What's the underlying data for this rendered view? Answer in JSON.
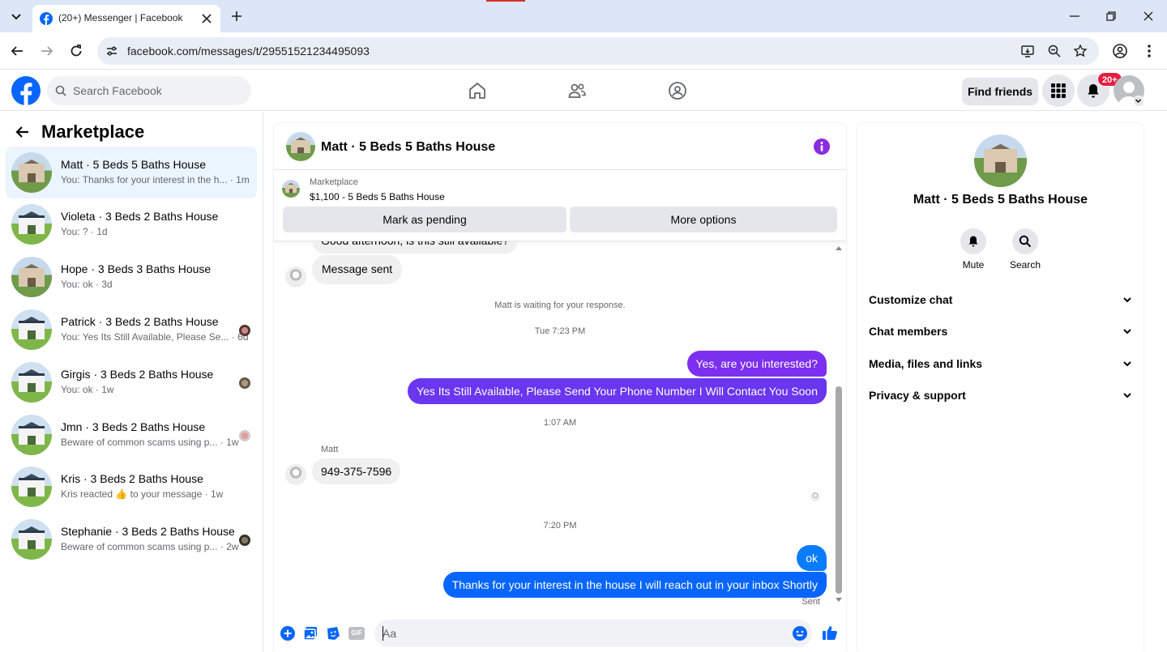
{
  "browser": {
    "tab_title": "(20+) Messenger | Facebook",
    "url": "facebook.com/messages/t/29551521234495093"
  },
  "header": {
    "search_placeholder": "Search Facebook",
    "find_friends": "Find friends",
    "notifications_badge": "20+"
  },
  "sidebar": {
    "title": "Marketplace",
    "conversations": [
      {
        "name": "Matt · 5 Beds 5 Baths House",
        "preview": "You: Thanks for your interest in the h... · 1m",
        "active": true
      },
      {
        "name": "Violeta · 3 Beds 2 Baths House",
        "preview": "You: ? · 1d"
      },
      {
        "name": "Hope · 3 Beds 3 Baths House",
        "preview": "You: ok · 3d"
      },
      {
        "name": "Patrick · 3 Beds 2 Baths House",
        "preview": "You: Yes Its Still Available, Please Se... · 6d"
      },
      {
        "name": "Girgis · 3 Beds 2 Baths House",
        "preview": "You: ok · 1w"
      },
      {
        "name": "Jmn · 3 Beds 2 Baths House",
        "preview": "Beware of common scams using p... · 1w"
      },
      {
        "name": "Kris · 3 Beds 2 Baths House",
        "preview": "Kris reacted 👍 to your message · 1w"
      },
      {
        "name": "Stephanie · 3 Beds 2 Baths House",
        "preview": "Beware of common scams using p... · 2w"
      }
    ]
  },
  "chat": {
    "title": "Matt · 5 Beds 5 Baths House",
    "listing_source": "Marketplace",
    "listing_title": "$1,100 - 5 Beds 5 Baths House",
    "mark_pending": "Mark as pending",
    "more_options": "More options",
    "partial_message": "Good afternoon, is this still available?",
    "message_sent": "Message sent",
    "waiting_notice": "Matt is waiting for your response.",
    "time1": "Tue 7:23 PM",
    "out1": "Yes, are you interested?",
    "out2": "Yes Its Still Available, Please Send Your Phone Number I Will Contact You Soon",
    "time2": "1:07 AM",
    "sender": "Matt",
    "in_phone": "949-375-7596",
    "time3": "7:20 PM",
    "out3": "ok",
    "out4": "Thanks for your interest in the house I will reach out in your inbox Shortly",
    "status": "Sent",
    "composer_placeholder": "Aa",
    "gif_label": "GIF"
  },
  "details": {
    "name": "Matt · 5 Beds 5 Baths House",
    "mute": "Mute",
    "search": "Search",
    "sections": [
      "Customize chat",
      "Chat members",
      "Media, files and links",
      "Privacy & support"
    ]
  },
  "colors": {
    "purple_bubble": "#7b2fef",
    "blue_bubble": "#0a7cff",
    "fb_blue": "#0866ff"
  }
}
